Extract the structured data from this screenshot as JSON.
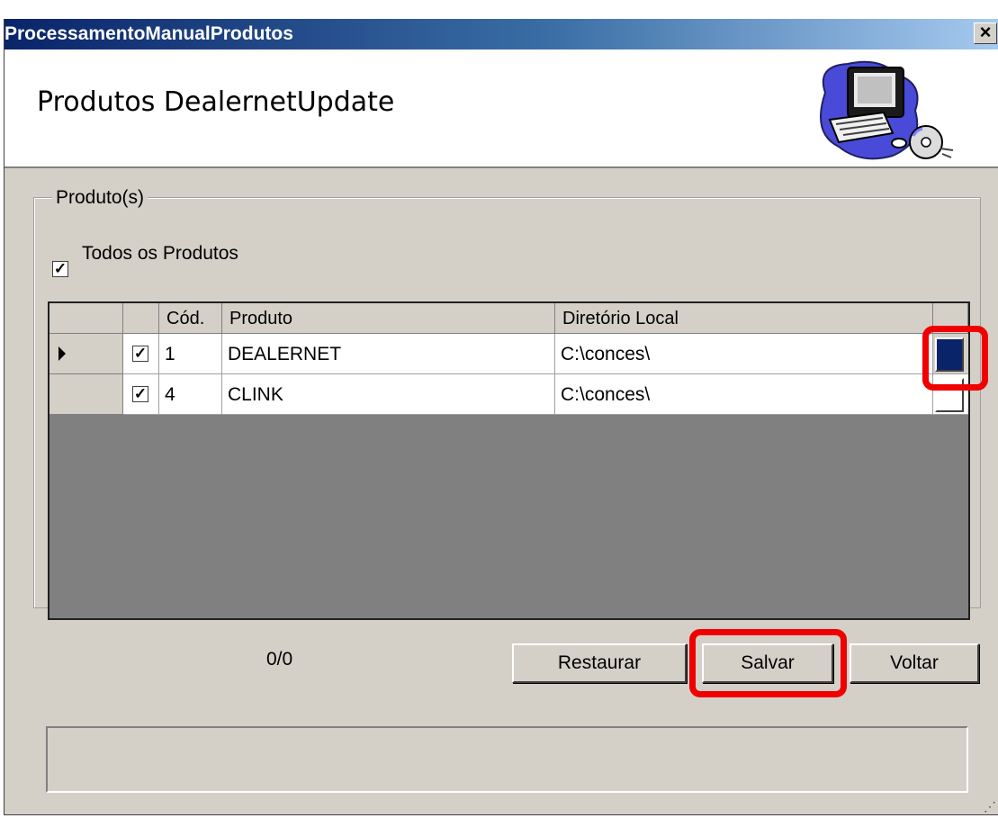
{
  "window": {
    "title": "ProcessamentoManualProdutos",
    "close_label": "×"
  },
  "header": {
    "title": "Produtos DealernetUpdate",
    "art_icon": "computer-cd-icon"
  },
  "group": {
    "legend": "Produto(s)",
    "select_all_label": "Todos os Produtos",
    "select_all_checked": true
  },
  "grid": {
    "columns": [
      "Cód.",
      "Produto",
      "Diretório Local"
    ],
    "rows": [
      {
        "checked": true,
        "codigo": "1",
        "produto": "DEALERNET",
        "diretorio": "C:\\conces\\",
        "current": true
      },
      {
        "checked": true,
        "codigo": "4",
        "produto": "CLINK",
        "diretorio": "C:\\conces\\",
        "current": false
      }
    ]
  },
  "footer": {
    "counter": "0/0",
    "restaurar_label": "Restaurar",
    "salvar_label": "Salvar",
    "voltar_label": "Voltar"
  },
  "colors": {
    "highlight": "#f00000",
    "title_bar": "#0a246a",
    "selected_button": "#0a246a"
  }
}
